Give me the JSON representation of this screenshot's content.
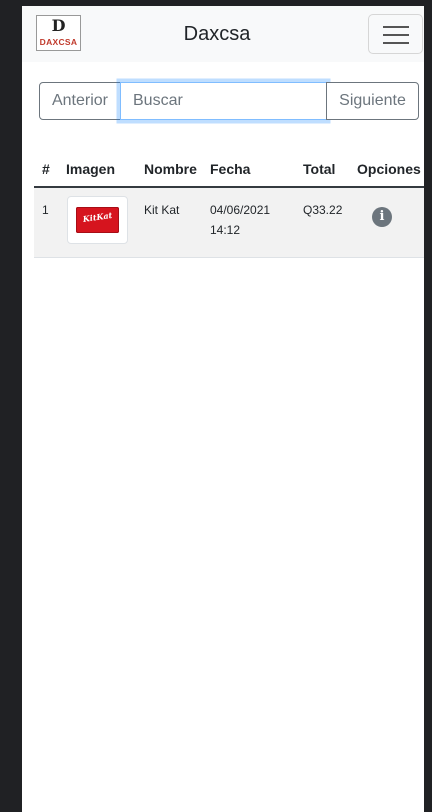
{
  "navbar": {
    "logo_letter": "D",
    "logo_word": "DAXCSA",
    "brand": "Daxcsa",
    "menu_icon": "hamburger-icon"
  },
  "search": {
    "prev_label": "Anterior",
    "placeholder": "Buscar",
    "value": "",
    "next_label": "Siguiente"
  },
  "table": {
    "headers": [
      "#",
      "Imagen",
      "Nombre",
      "Fecha",
      "Total",
      "Opciones"
    ],
    "rows": [
      {
        "num": "1",
        "image_icon": "kitkat-product-image",
        "image_text": "KitKat",
        "name": "Kit Kat",
        "date": "04/06/2021",
        "time": "14:12",
        "total": "Q33.22",
        "options_icon": "info-icon"
      }
    ]
  },
  "colors": {
    "accent": "#80bdff",
    "button": "#6c757d",
    "navbar_bg": "#f8f9fa",
    "row_bg": "#f2f2f2",
    "logo_red": "#c0392b",
    "kitkat_red": "#d6141e"
  }
}
